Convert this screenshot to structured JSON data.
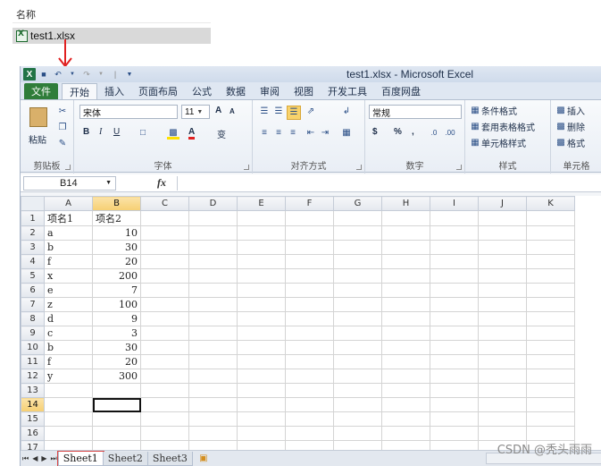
{
  "explorer": {
    "column_header": "名称",
    "file_name": "test1.xlsx"
  },
  "titlebar": {
    "title": "test1.xlsx - Microsoft Excel",
    "app_icon": "excel-logo",
    "qat_separator": "|"
  },
  "tabs": [
    {
      "label": "文件"
    },
    {
      "label": "开始"
    },
    {
      "label": "插入"
    },
    {
      "label": "页面布局"
    },
    {
      "label": "公式"
    },
    {
      "label": "数据"
    },
    {
      "label": "审阅"
    },
    {
      "label": "视图"
    },
    {
      "label": "开发工具"
    },
    {
      "label": "百度网盘"
    }
  ],
  "ribbon": {
    "clipboard": {
      "label": "剪贴板",
      "paste": "粘贴"
    },
    "font": {
      "label": "字体",
      "name": "宋体",
      "size": "11",
      "bold": "B",
      "italic": "I",
      "underline": "U",
      "grow": "A",
      "shrink": "A",
      "color_a": "A",
      "wen": "变"
    },
    "alignment": {
      "label": "对齐方式"
    },
    "number": {
      "label": "数字",
      "format": "常规",
      "currency": "$",
      "percent": "%",
      "comma": ","
    },
    "styles": {
      "label": "样式",
      "conditional": "条件格式",
      "table": "套用表格格式",
      "cell": "单元格样式"
    },
    "cells": {
      "label": "单元格",
      "insert": "插入",
      "delete": "删除",
      "format": "格式"
    }
  },
  "formula_bar": {
    "name_box": "B14",
    "fx": "fx",
    "formula": ""
  },
  "grid": {
    "columns": [
      "A",
      "B",
      "C",
      "D",
      "E",
      "F",
      "G",
      "H",
      "I",
      "J",
      "K"
    ],
    "rows": [
      {
        "n": "1",
        "a": "项名1",
        "b": "项名2"
      },
      {
        "n": "2",
        "a": "a",
        "b": "10"
      },
      {
        "n": "3",
        "a": "b",
        "b": "30"
      },
      {
        "n": "4",
        "a": "f",
        "b": "20"
      },
      {
        "n": "5",
        "a": "x",
        "b": "200"
      },
      {
        "n": "6",
        "a": "e",
        "b": "7"
      },
      {
        "n": "7",
        "a": "z",
        "b": "100"
      },
      {
        "n": "8",
        "a": "d",
        "b": "9"
      },
      {
        "n": "9",
        "a": "c",
        "b": "3"
      },
      {
        "n": "10",
        "a": "b",
        "b": "30"
      },
      {
        "n": "11",
        "a": "f",
        "b": "20"
      },
      {
        "n": "12",
        "a": "y",
        "b": "300"
      },
      {
        "n": "13",
        "a": "",
        "b": ""
      },
      {
        "n": "14",
        "a": "",
        "b": ""
      },
      {
        "n": "15",
        "a": "",
        "b": ""
      },
      {
        "n": "16",
        "a": "",
        "b": ""
      },
      {
        "n": "17",
        "a": "",
        "b": ""
      }
    ],
    "active_cell": "B14"
  },
  "sheets": [
    "Sheet1",
    "Sheet2",
    "Sheet3"
  ],
  "watermark": "CSDN @秃头雨雨"
}
